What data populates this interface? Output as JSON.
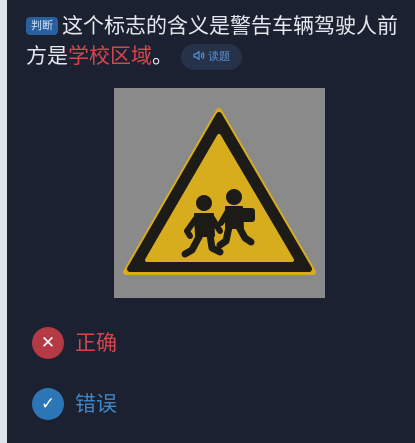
{
  "question": {
    "type_badge": "判断",
    "text_before": "这个标志的含义是警告车辆驾驶人前方是",
    "text_highlight": "学校区域",
    "text_after": "。",
    "read_button": {
      "icon": "speaker-icon",
      "label": "读题"
    }
  },
  "sign": {
    "description_icon": "children-crossing-warning-sign",
    "colors": {
      "background": "#8a8a8b",
      "border": "#1c1b17",
      "fill": "#d7ad1d"
    }
  },
  "options": [
    {
      "icon": "x-icon",
      "symbol": "✕",
      "label": "正确",
      "color": "#d6454d"
    },
    {
      "icon": "check-icon",
      "symbol": "✓",
      "label": "错误",
      "color": "#3f86c8"
    }
  ],
  "colors": {
    "page_background": "#1b2130",
    "text": "#e5e8ee",
    "highlight": "#d6454d",
    "accent_blue": "#2c76b8"
  }
}
